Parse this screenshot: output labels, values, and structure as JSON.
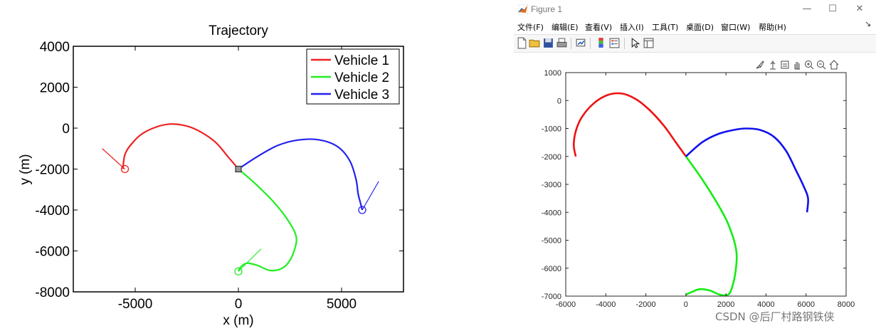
{
  "left_figure": {
    "chart_data": {
      "type": "line",
      "title": "Trajectory",
      "xlabel": "x (m)",
      "ylabel": "y (m)",
      "xlim": [
        -8000,
        8000
      ],
      "ylim": [
        -8000,
        4000
      ],
      "xticks": [
        -5000,
        0,
        5000
      ],
      "xtick_labels": [
        "-5000",
        "0",
        "5000"
      ],
      "yticks": [
        4000,
        2000,
        0,
        -2000,
        -4000,
        -6000,
        -8000
      ],
      "ytick_labels": [
        "4000",
        "2000",
        "0",
        "-2000",
        "-4000",
        "-6000",
        "-8000"
      ],
      "grid": false,
      "legend_position": "top-right",
      "series": [
        {
          "name": "Vehicle 1",
          "color": "#ee2222",
          "x": [
            0,
            -500,
            -1100,
            -1800,
            -2500,
            -3300,
            -4000,
            -4700,
            -5200,
            -5500,
            -5600
          ],
          "y": [
            -2000,
            -1400,
            -700,
            -200,
            100,
            200,
            50,
            -300,
            -800,
            -1300,
            -2000
          ]
        },
        {
          "name": "Vehicle 2",
          "color": "#22ee22",
          "x": [
            0,
            800,
            1700,
            2400,
            2800,
            2700,
            2400,
            2000,
            1500,
            900,
            400,
            100,
            0
          ],
          "y": [
            -2000,
            -2700,
            -3600,
            -4500,
            -5300,
            -6000,
            -6600,
            -6900,
            -6950,
            -6700,
            -6600,
            -6800,
            -7000
          ]
        },
        {
          "name": "Vehicle 3",
          "color": "#2222ee",
          "x": [
            0,
            900,
            1900,
            2900,
            3900,
            4800,
            5400,
            5700,
            5800,
            5900,
            6000
          ],
          "y": [
            -2000,
            -1400,
            -850,
            -580,
            -570,
            -900,
            -1600,
            -2500,
            -3200,
            -3600,
            -4000
          ]
        }
      ],
      "start_markers": [
        {
          "x": -5500,
          "y": -2000,
          "color": "#ee2222"
        },
        {
          "x": 0,
          "y": -7000,
          "color": "#22ee22"
        },
        {
          "x": 6000,
          "y": -4000,
          "color": "#2222ee"
        }
      ],
      "heading_lines": [
        {
          "x1": -5500,
          "y1": -2000,
          "x2": -6600,
          "y2": -1000,
          "color": "#ee2222"
        },
        {
          "x1": 0,
          "y1": -7000,
          "x2": 1100,
          "y2": -5900,
          "color": "#22ee22"
        },
        {
          "x1": 6000,
          "y1": -4000,
          "x2": 6800,
          "y2": -2600,
          "color": "#2222ee"
        }
      ],
      "goal_marker": {
        "x": 0,
        "y": -2000,
        "color": "#555555"
      }
    }
  },
  "figure_window": {
    "title": "Figure 1",
    "window_controls": [
      "—",
      "☐",
      "✕"
    ],
    "menu": [
      "文件(F)",
      "编辑(E)",
      "查看(V)",
      "插入(I)",
      "工具(T)",
      "桌面(D)",
      "窗口(W)",
      "帮助(H)"
    ],
    "menu_more": "↘",
    "toolbar_icons": [
      "new-file-icon",
      "open-folder-icon",
      "save-icon",
      "print-icon",
      "link-plot-icon",
      "colorbar-icon",
      "legend-icon",
      "pointer-icon",
      "property-inspector-icon"
    ],
    "axes_toolbar_icons": [
      "brush-icon",
      "data-tips-icon",
      "rotate-icon",
      "pan-icon",
      "zoom-in-icon",
      "zoom-out-icon",
      "home-icon"
    ],
    "chart_data": {
      "type": "line",
      "xlim": [
        -6000,
        8000
      ],
      "ylim": [
        -7000,
        1000
      ],
      "xticks": [
        -6000,
        -4000,
        -2000,
        0,
        2000,
        4000,
        6000,
        8000
      ],
      "xtick_labels": [
        "-6000",
        "-4000",
        "-2000",
        "0",
        "2000",
        "4000",
        "6000",
        "8000"
      ],
      "yticks": [
        1000,
        0,
        -1000,
        -2000,
        -3000,
        -4000,
        -5000,
        -6000,
        -7000
      ],
      "ytick_labels": [
        "1000",
        "0",
        "-1000",
        "-2000",
        "-3000",
        "-4000",
        "-5000",
        "-6000",
        "-7000"
      ],
      "grid": false,
      "series": [
        {
          "color": "#ee1111",
          "x": [
            0,
            -500,
            -1100,
            -1800,
            -2500,
            -3200,
            -3900,
            -4600,
            -5200,
            -5500,
            -5600,
            -5500
          ],
          "y": [
            -2000,
            -1500,
            -900,
            -350,
            50,
            250,
            200,
            -100,
            -600,
            -1100,
            -1600,
            -2000
          ]
        },
        {
          "color": "#11ee11",
          "x": [
            0,
            700,
            1500,
            2100,
            2500,
            2500,
            2300,
            2100,
            1700,
            1200,
            700,
            300,
            0
          ],
          "y": [
            -2000,
            -2700,
            -3600,
            -4400,
            -5300,
            -6000,
            -6700,
            -6950,
            -6950,
            -6800,
            -6750,
            -6850,
            -6950
          ]
        },
        {
          "color": "#1111ee",
          "x": [
            0,
            800,
            1600,
            2400,
            3000,
            3700,
            4400,
            5000,
            5500,
            5900,
            6100,
            6050
          ],
          "y": [
            -2000,
            -1500,
            -1200,
            -1050,
            -1000,
            -1050,
            -1300,
            -1800,
            -2500,
            -3100,
            -3500,
            -4000
          ]
        }
      ]
    }
  },
  "watermark": "CSDN @后厂村路钢铁侠"
}
